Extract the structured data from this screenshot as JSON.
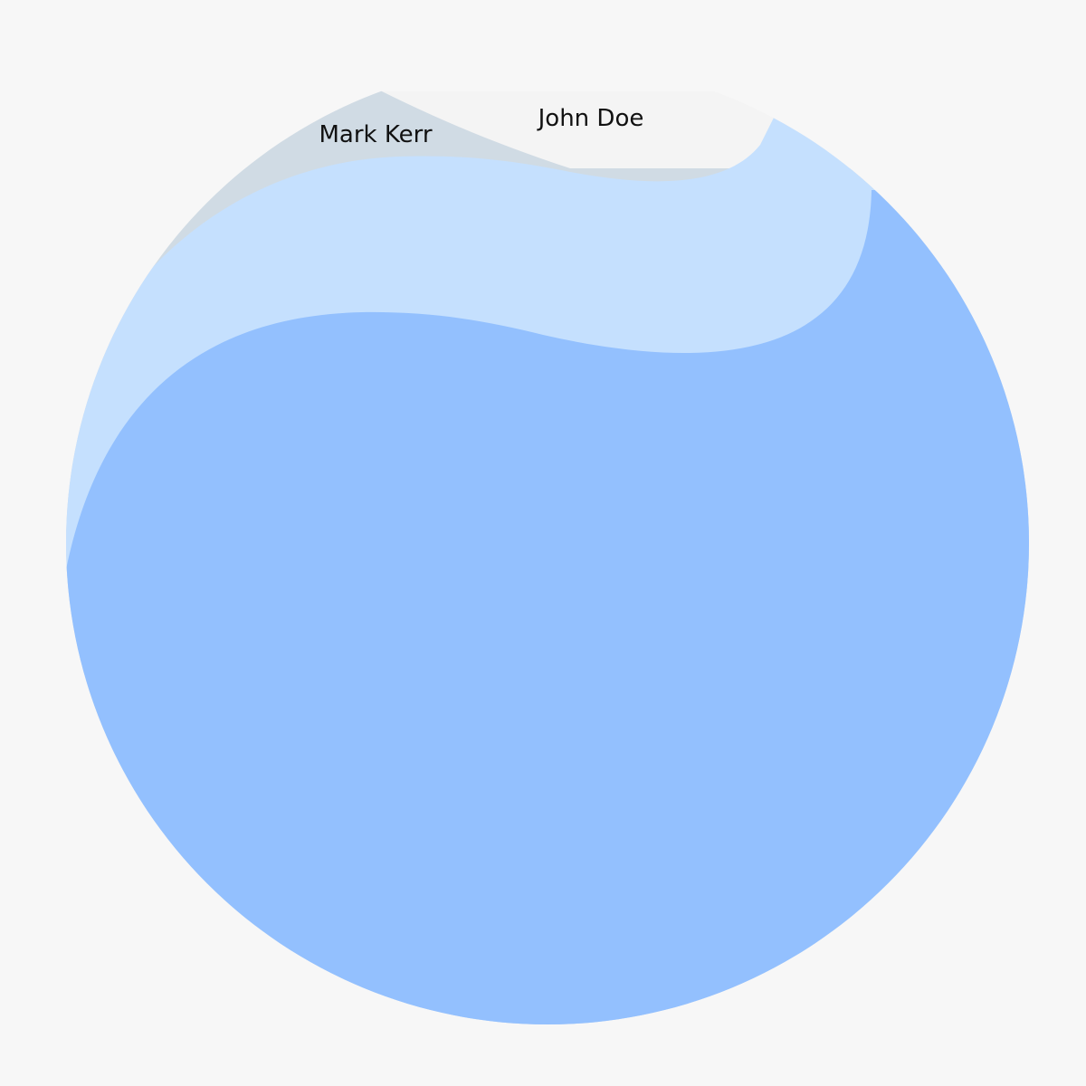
{
  "chart_data": {
    "type": "area",
    "shape": "circular wave layers",
    "background": "#f7f7f7",
    "series": [
      {
        "name": "John Doe",
        "color": "#f4f4f4",
        "label": "John Doe"
      },
      {
        "name": "Mark Kerr",
        "color": "#d0dbe4",
        "label": "Mark Kerr"
      },
      {
        "name": "",
        "color": "#c5e0fe",
        "label": ""
      },
      {
        "name": "",
        "color": "#93c0fe",
        "label": ""
      }
    ]
  }
}
